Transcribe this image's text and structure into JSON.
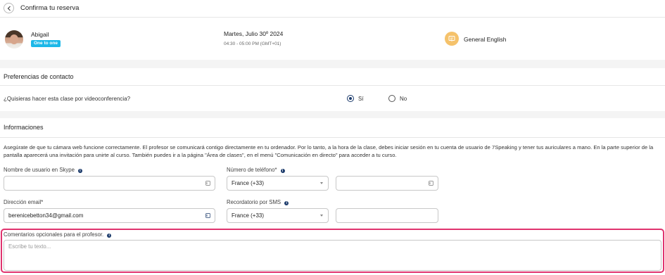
{
  "header": {
    "title": "Confirma tu reserva"
  },
  "booking": {
    "teacher_name": "Abigail",
    "badge": "One to one",
    "date": "Martes, Julio 30º 2024",
    "time": "04:30 - 05:00 PM (GMT+01)",
    "course": "General English"
  },
  "contact": {
    "title": "Preferencias de contacto",
    "question": "¿Quisieras hacer esta clase por videoconferencia?",
    "options": [
      {
        "label": "Sí",
        "selected": true
      },
      {
        "label": "No",
        "selected": false
      }
    ]
  },
  "info": {
    "title": "Informaciones",
    "text": "Asegúrate de que tu cámara web funcione correctamente. El profesor se comunicará contigo directamente en tu ordenador. Por lo tanto, a la hora de la clase, debes iniciar sesión en tu cuenta de usuario de 7Speaking y tener tus auriculares a mano. En la parte superior de la pantalla aparecerá una invitación para unirte al curso. También puedes ir a la página \"Área de clases\", en el menú \"Comunicación en directo\" para acceder a tu curso.",
    "fields": {
      "skype_label": "Nombre de usuario en Skype",
      "skype_value": "",
      "phone_label": "Número de teléfono*",
      "phone_country": "France (+33)",
      "phone_value": "",
      "email_label": "Dirección email*",
      "email_value": "berenicebetton34@gmail.com",
      "sms_label": "Recordatorio por SMS",
      "sms_country": "France (+33)",
      "sms_value": "",
      "comments_label": "Comentarios opcionales para el profesor.",
      "comments_placeholder": "Escribe tu texto..."
    }
  },
  "colors": {
    "accent": "#1db8e8",
    "highlight": "#e0336e",
    "radio": "#1b3a6b",
    "course_icon": "#f5c26b"
  },
  "icons": {
    "back": "chevron-left-icon",
    "course": "course-icon",
    "info": "info-icon",
    "input": "contact-card-icon"
  }
}
